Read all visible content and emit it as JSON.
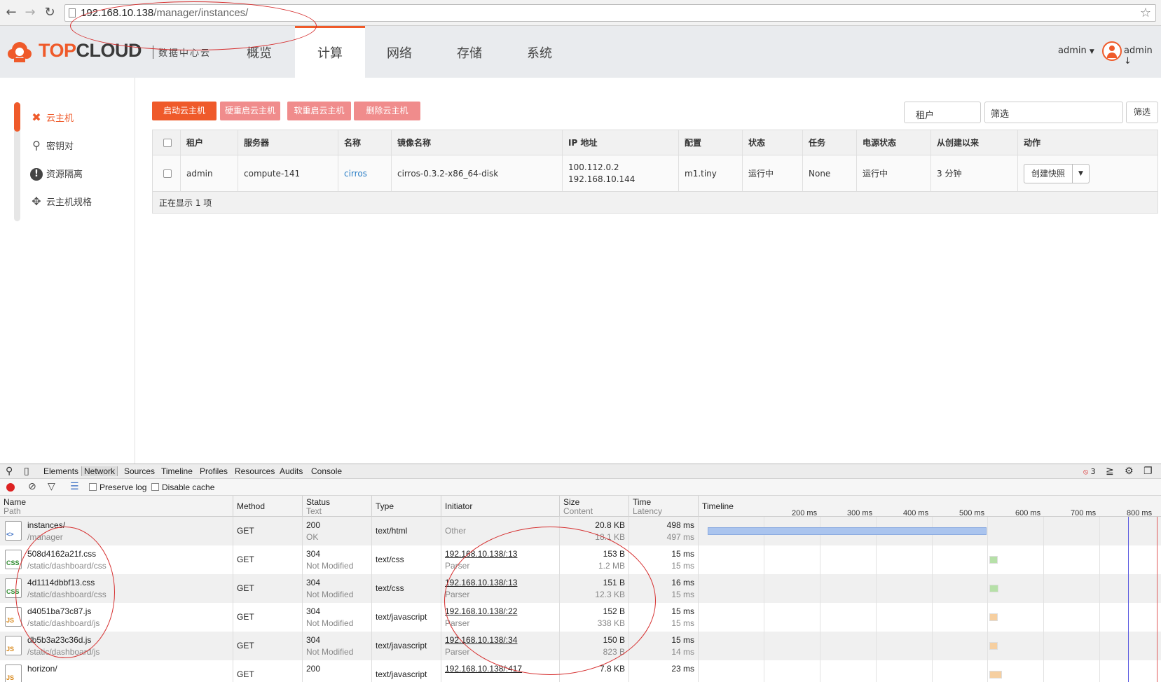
{
  "browser": {
    "url_host": "192.168.10.138",
    "url_path": "/manager/instances/"
  },
  "header": {
    "logo_top": "TOP",
    "logo_cloud": "CLOUD",
    "logo_sub": "数据中心云",
    "tabs": [
      {
        "label": "概览"
      },
      {
        "label": "计算"
      },
      {
        "label": "网络"
      },
      {
        "label": "存储"
      },
      {
        "label": "系统"
      }
    ],
    "project_label": "admin",
    "user_label": "admin"
  },
  "sidebar": {
    "items": [
      {
        "label": "云主机",
        "icon": "cross-icon"
      },
      {
        "label": "密钥对",
        "icon": "key-icon"
      },
      {
        "label": "资源隔离",
        "icon": "exclamation-icon"
      },
      {
        "label": "云主机规格",
        "icon": "move-icon"
      }
    ]
  },
  "actions": {
    "start": "启动云主机",
    "hard_reboot": "硬重启云主机",
    "soft_reboot": "软重启云主机",
    "delete": "删除云主机"
  },
  "filter": {
    "select_value": "租户",
    "input_value": "筛选",
    "button_label": "筛选"
  },
  "table": {
    "headers": [
      "租户",
      "服务器",
      "名称",
      "镜像名称",
      "IP 地址",
      "配置",
      "状态",
      "任务",
      "电源状态",
      "从创建以来",
      "动作"
    ],
    "rows": [
      {
        "tenant": "admin",
        "host": "compute-141",
        "name": "cirros",
        "image": "cirros-0.3.2-x86_64-disk",
        "ip1": "100.112.0.2",
        "ip2": "192.168.10.144",
        "flavor": "m1.tiny",
        "status": "运行中",
        "task": "None",
        "power": "运行中",
        "age": "3 分钟",
        "action": "创建快照"
      }
    ],
    "footer": "正在显示 1 项"
  },
  "devtools": {
    "tabs": [
      "Elements",
      "Network",
      "Sources",
      "Timeline",
      "Profiles",
      "Resources",
      "Audits",
      "Console"
    ],
    "error_count": "3",
    "preserve_log": "Preserve log",
    "disable_cache": "Disable cache",
    "columns": {
      "name": "Name",
      "path": "Path",
      "method": "Method",
      "status": "Status",
      "text": "Text",
      "type": "Type",
      "initiator": "Initiator",
      "size": "Size",
      "content": "Content",
      "time": "Time",
      "latency": "Latency",
      "timeline": "Timeline"
    },
    "ticks": [
      "200 ms",
      "300 ms",
      "400 ms",
      "500 ms",
      "600 ms",
      "700 ms",
      "800 ms"
    ],
    "requests": [
      {
        "name": "instances/",
        "path": "/manager",
        "method": "GET",
        "status": "200",
        "status_text": "OK",
        "type": "text/html",
        "initiator": "Other",
        "initiator_sub": "",
        "size": "20.8 KB",
        "content": "18.1 KB",
        "time": "498 ms",
        "latency": "497 ms",
        "icon": "html-file-icon",
        "icon_label": "<>",
        "icon_color": "#3b6fc4",
        "bar_color": "#aac4ee"
      },
      {
        "name": "508d4162a21f.css",
        "path": "/static/dashboard/css",
        "method": "GET",
        "status": "304",
        "status_text": "Not Modified",
        "type": "text/css",
        "initiator": "192.168.10.138/:13",
        "initiator_sub": "Parser",
        "size": "153 B",
        "content": "1.2 MB",
        "time": "15 ms",
        "latency": "15 ms",
        "icon": "css-file-icon",
        "icon_label": "CSS",
        "icon_color": "#2f8a2f",
        "bar_color": "#b6e0a8"
      },
      {
        "name": "4d1114dbbf13.css",
        "path": "/static/dashboard/css",
        "method": "GET",
        "status": "304",
        "status_text": "Not Modified",
        "type": "text/css",
        "initiator": "192.168.10.138/:13",
        "initiator_sub": "Parser",
        "size": "151 B",
        "content": "12.3 KB",
        "time": "16 ms",
        "latency": "15 ms",
        "icon": "css-file-icon",
        "icon_label": "CSS",
        "icon_color": "#2f8a2f",
        "bar_color": "#b6e0a8"
      },
      {
        "name": "d4051ba73c87.js",
        "path": "/static/dashboard/js",
        "method": "GET",
        "status": "304",
        "status_text": "Not Modified",
        "type": "text/javascript",
        "initiator": "192.168.10.138/:22",
        "initiator_sub": "Parser",
        "size": "152 B",
        "content": "338 KB",
        "time": "15 ms",
        "latency": "15 ms",
        "icon": "js-file-icon",
        "icon_label": "JS",
        "icon_color": "#d98a1e",
        "bar_color": "#f6cfa0"
      },
      {
        "name": "db5b3a23c36d.js",
        "path": "/static/dashboard/js",
        "method": "GET",
        "status": "304",
        "status_text": "Not Modified",
        "type": "text/javascript",
        "initiator": "192.168.10.138/:34",
        "initiator_sub": "Parser",
        "size": "150 B",
        "content": "823 B",
        "time": "15 ms",
        "latency": "14 ms",
        "icon": "js-file-icon",
        "icon_label": "JS",
        "icon_color": "#d98a1e",
        "bar_color": "#f6cfa0"
      },
      {
        "name": "horizon/",
        "path": "",
        "method": "GET",
        "status": "200",
        "status_text": "",
        "type": "text/javascript",
        "initiator": "192.168.10.138/:417",
        "initiator_sub": "",
        "size": "7.8 KB",
        "content": "",
        "time": "23 ms",
        "latency": "",
        "icon": "js-file-icon",
        "icon_label": "JS",
        "icon_color": "#d98a1e",
        "bar_color": "#f6cfa0"
      }
    ]
  },
  "colors": {
    "brand": "#ef5a2a",
    "annotation": "#d63030"
  }
}
